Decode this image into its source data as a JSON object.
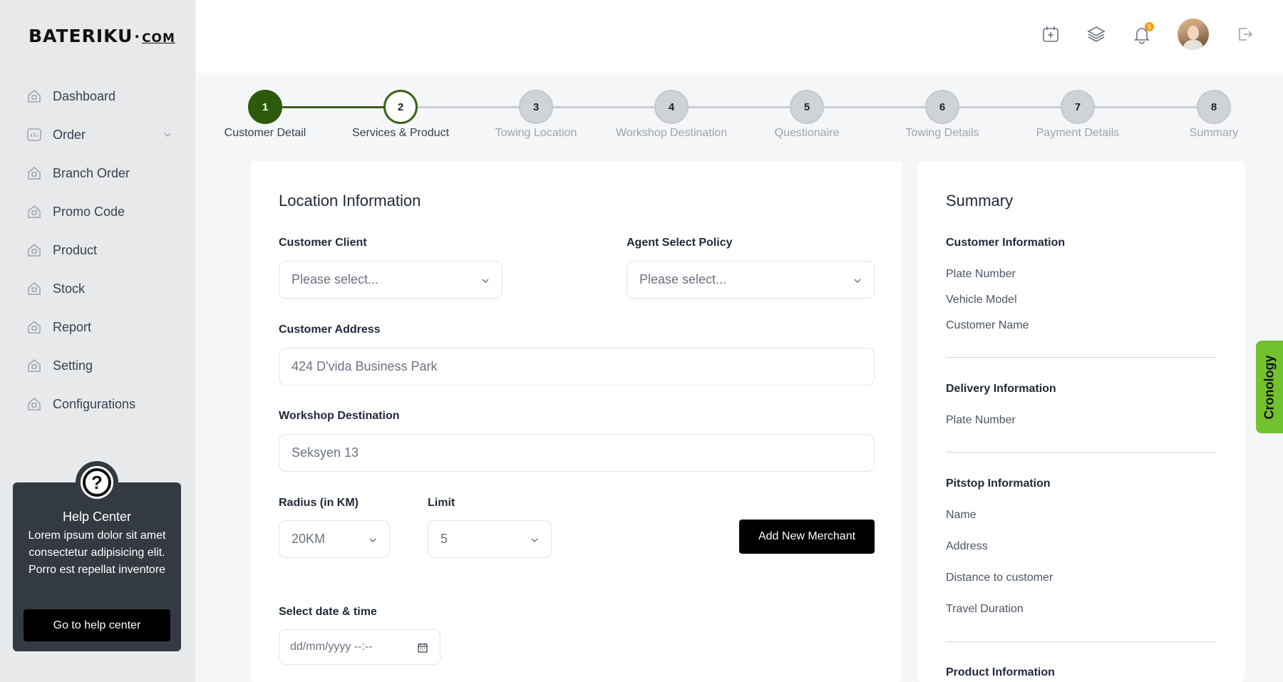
{
  "brand": {
    "logo_main": "BATERIKU",
    "logo_dot": "•",
    "logo_com": "COM"
  },
  "sidebar": {
    "items": [
      {
        "label": "Dashboard"
      },
      {
        "label": "Order"
      },
      {
        "label": "Branch Order"
      },
      {
        "label": "Promo Code"
      },
      {
        "label": "Product"
      },
      {
        "label": "Stock"
      },
      {
        "label": "Report"
      },
      {
        "label": "Setting"
      },
      {
        "label": "Configurations"
      }
    ]
  },
  "help": {
    "icon": "?",
    "title": "Help Center",
    "text": "Lorem ipsum dolor sit amet consectetur adipisicing elit. Porro est repellat inventore",
    "button": "Go to help center"
  },
  "topbar": {
    "notification_count": "5"
  },
  "stepper": {
    "steps": [
      {
        "num": "1",
        "label": "Customer Detail"
      },
      {
        "num": "2",
        "label": "Services & Product"
      },
      {
        "num": "3",
        "label": "Towing Location"
      },
      {
        "num": "4",
        "label": "Workshop Destination"
      },
      {
        "num": "5",
        "label": "Questionaire"
      },
      {
        "num": "6",
        "label": "Towing Details"
      },
      {
        "num": "7",
        "label": "Payment Details"
      },
      {
        "num": "8",
        "label": "Summary"
      }
    ]
  },
  "form": {
    "title": "Location Information",
    "customer_client": {
      "label": "Customer Client",
      "value": "Please select..."
    },
    "agent_policy": {
      "label": "Agent Select Policy",
      "value": "Please select..."
    },
    "customer_address": {
      "label": "Customer Address",
      "value": "424 D'vida Business Park"
    },
    "workshop_destination": {
      "label": "Workshop Destination",
      "value": "Seksyen 13"
    },
    "radius": {
      "label": "Radius (in KM)",
      "value": "20KM"
    },
    "limit": {
      "label": "Limit",
      "value": "5"
    },
    "add_merchant": "Add New Merchant",
    "datetime": {
      "label": "Select date & time",
      "value": "dd/mm/yyyy --:--"
    }
  },
  "summary": {
    "title": "Summary",
    "customer": {
      "heading": "Customer Information",
      "fields": [
        "Plate Number",
        "Vehicle Model",
        "Customer Name"
      ]
    },
    "delivery": {
      "heading": "Delivery Information",
      "fields": [
        "Plate Number"
      ]
    },
    "pitstop": {
      "heading": "Pitstop Information",
      "fields": [
        "Name",
        "Address",
        "Distance to customer",
        "Travel Duration"
      ]
    },
    "product": {
      "heading": "Product Information"
    }
  },
  "cronology_tab": "Cronology",
  "colors": {
    "accent_green": "#2c5a0a",
    "tab_green": "#72c12f",
    "help_bg": "#343a42"
  }
}
